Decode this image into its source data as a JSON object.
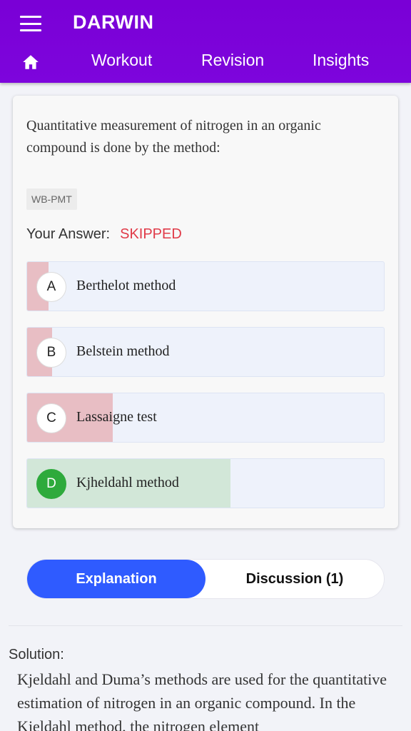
{
  "app": {
    "title": "DARWIN",
    "nav": {
      "workout": "Workout",
      "revision": "Revision",
      "insights": "Insights"
    }
  },
  "question": {
    "text": "Quantitative measurement of nitrogen in an organic compound is done by the method:",
    "tag": "WB-PMT",
    "your_answer_label": "Your Answer:",
    "your_answer_value": "SKIPPED",
    "options": [
      {
        "letter": "A",
        "text": "Berthelot method",
        "percent": 6,
        "correct": false
      },
      {
        "letter": "B",
        "text": "Belstein method",
        "percent": 7,
        "correct": false
      },
      {
        "letter": "C",
        "text": "Lassaigne test",
        "percent": 24,
        "correct": false
      },
      {
        "letter": "D",
        "text": "Kjheldahl method",
        "percent": 57,
        "correct": true
      }
    ]
  },
  "tabs": {
    "explanation": "Explanation",
    "discussion": "Discussion (1)"
  },
  "solution": {
    "label": "Solution:",
    "text": "Kjeldahl and Duma’s methods are used for the quantitative estimation of nitrogen in an organic compound. In the Kjeldahl method, the nitrogen element"
  },
  "colors": {
    "appbar": "#7a00d6",
    "wrong_fill": "#e8bec4",
    "right_fill": "#d2e7d8",
    "correct_badge": "#2eaa3c",
    "skipped": "#e03a48",
    "active_tab": "#2f5bff"
  }
}
